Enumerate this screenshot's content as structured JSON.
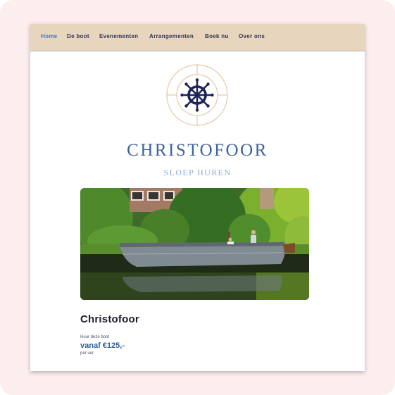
{
  "nav": {
    "items": [
      "Home",
      "De boot",
      "Evenementen",
      "Arrangementen",
      "Boek nu",
      "Over ons"
    ],
    "active": "Home"
  },
  "logo": {
    "icon": "ship-wheel-icon"
  },
  "brand": {
    "name": "CHRISTOFOOR",
    "tagline": "SLOEP HUREN"
  },
  "hero_image": {
    "subject": "boat-photo"
  },
  "boat": {
    "title": "Christofoor",
    "rent_label": "Huur deze boot",
    "price": "vanaf €125,-",
    "price_unit": "per uur"
  },
  "colors": {
    "nav_bg": "#e8d5bd",
    "nav_text": "#2f3553",
    "nav_active": "#3d79c8",
    "brand": "#3d62a0",
    "tagline": "#8daad7",
    "price": "#2f5e9e",
    "page_bg": "#fdeeee"
  }
}
